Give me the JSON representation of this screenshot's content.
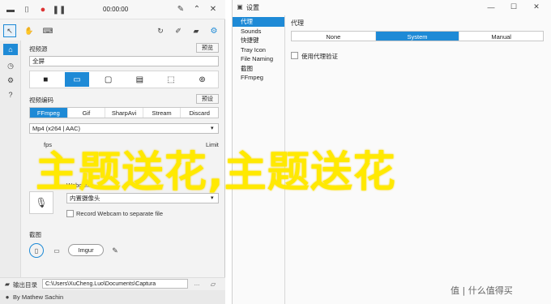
{
  "left_window": {
    "title": "00:00:00",
    "section_video": "视频源",
    "preset_label": "预览",
    "fullscreen_value": "全屏",
    "section_format": "视频编码",
    "preset2_label": "预设",
    "format_tabs": [
      {
        "label": "FFmpeg",
        "active": true
      },
      {
        "label": "Gif",
        "active": false
      },
      {
        "label": "SharpAvi",
        "active": false
      },
      {
        "label": "Stream",
        "active": false
      },
      {
        "label": "Discard",
        "active": false
      }
    ],
    "codec_value": "Mp4 (x264 | AAC)",
    "frame_rate_value": "fps",
    "limit_label": "Limit",
    "webcam_label": "Webcam",
    "webcam_value": "内置摄像头",
    "record_webcam_label": "Record Webcam to separate file",
    "section_screenshot": "截图",
    "imgur_label": "Imgur",
    "output_label": "输出目录",
    "output_path": "C:\\Users\\XuCheng.Luo\\Documents\\Captura",
    "author": "By Mathew Sachin"
  },
  "right_window": {
    "title": "设置",
    "nav_items": [
      {
        "label": "代理",
        "active": true
      },
      {
        "label": "Sounds",
        "active": false
      },
      {
        "label": "快捷键",
        "active": false
      },
      {
        "label": "Tray Icon",
        "active": false
      },
      {
        "label": "File Naming",
        "active": false
      },
      {
        "label": "截图",
        "active": false
      },
      {
        "label": "FFmpeg",
        "active": false
      }
    ],
    "section_title": "代理",
    "proxy_modes": [
      {
        "label": "None",
        "active": false
      },
      {
        "label": "System",
        "active": true
      },
      {
        "label": "Manual",
        "active": false
      }
    ],
    "auth_checkbox_label": "使用代理验证"
  },
  "overlay_text": "主题送花,主题送花",
  "watermark": "值 | 什么值得买",
  "colors": {
    "accent": "#1e8ad6",
    "overlay": "#ffe900"
  }
}
